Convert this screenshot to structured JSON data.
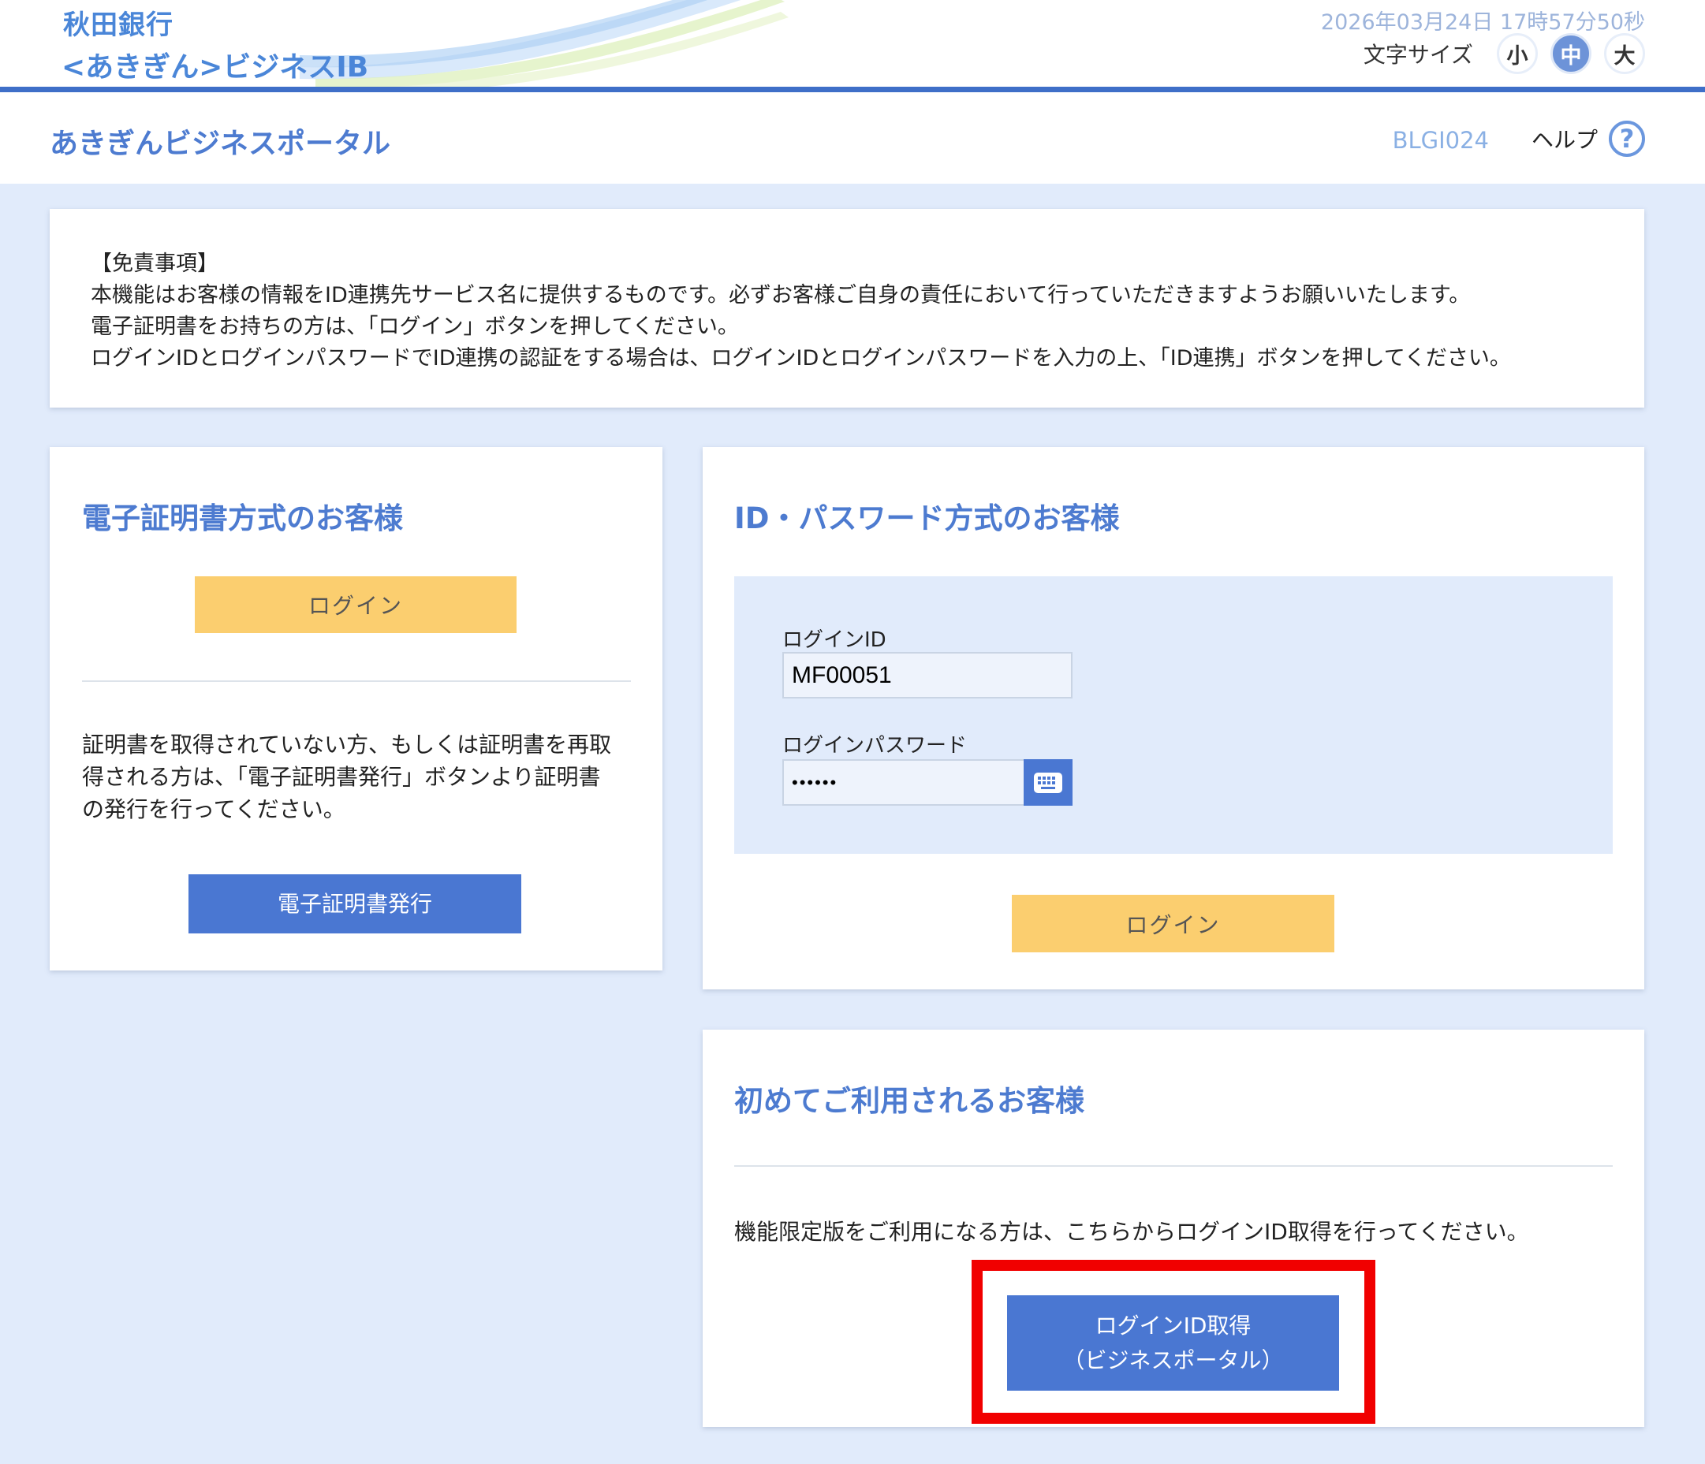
{
  "header": {
    "bank_name": "秋田銀行",
    "service_name": "<あきぎん>ビジネスIB",
    "datetime": "2026年03月24日 17時57分50秒",
    "font_size_label": "文字サイズ",
    "font_size_options": [
      "小",
      "中",
      "大"
    ],
    "font_size_selected": "中"
  },
  "title_bar": {
    "title": "あきぎんビジネスポータル",
    "screen_id": "BLGI024",
    "help_label": "ヘルプ",
    "help_icon": "?"
  },
  "disclaimer": {
    "lines": [
      "【免責事項】",
      " 本機能はお客様の情報をID連携先サービス名に提供するものです。必ずお客様ご自身の責任において行っていただきますようお願いいたします。",
      "電子証明書をお持ちの方は、「ログイン」ボタンを押してください。",
      "ログインIDとログインパスワードでID連携の認証をする場合は、ログインIDとログインパスワードを入力の上、「ID連携」ボタンを押してください。"
    ]
  },
  "cert_section": {
    "title": "電子証明書方式のお客様",
    "login_button": "ログイン",
    "description_lines": [
      "証明書を取得されていない方、もしくは証明書を再取",
      "得される方は、「電子証明書発行」ボタンより証明書",
      "の発行を行ってください。"
    ],
    "issue_button": "電子証明書発行"
  },
  "id_section": {
    "title": "ID・パスワード方式のお客様",
    "login_id_label": "ログインID",
    "login_id_value": "MF00051",
    "password_label": "ログインパスワード",
    "password_value": "••••••",
    "login_button": "ログイン"
  },
  "first_time_section": {
    "title": "初めてご利用されるお客様",
    "description": "機能限定版をご利用になる方は、こちらからログインID取得を行ってください。",
    "button_line1": "ログインID取得",
    "button_line2": "（ビジネスポータル）"
  },
  "colors": {
    "accent_blue": "#4a77d2",
    "button_yellow": "#fbce6f",
    "page_background": "#e1ebfb",
    "highlight_red": "#f10000"
  },
  "icons": {
    "keyboard": "keyboard-icon",
    "help": "help-circle-icon"
  }
}
